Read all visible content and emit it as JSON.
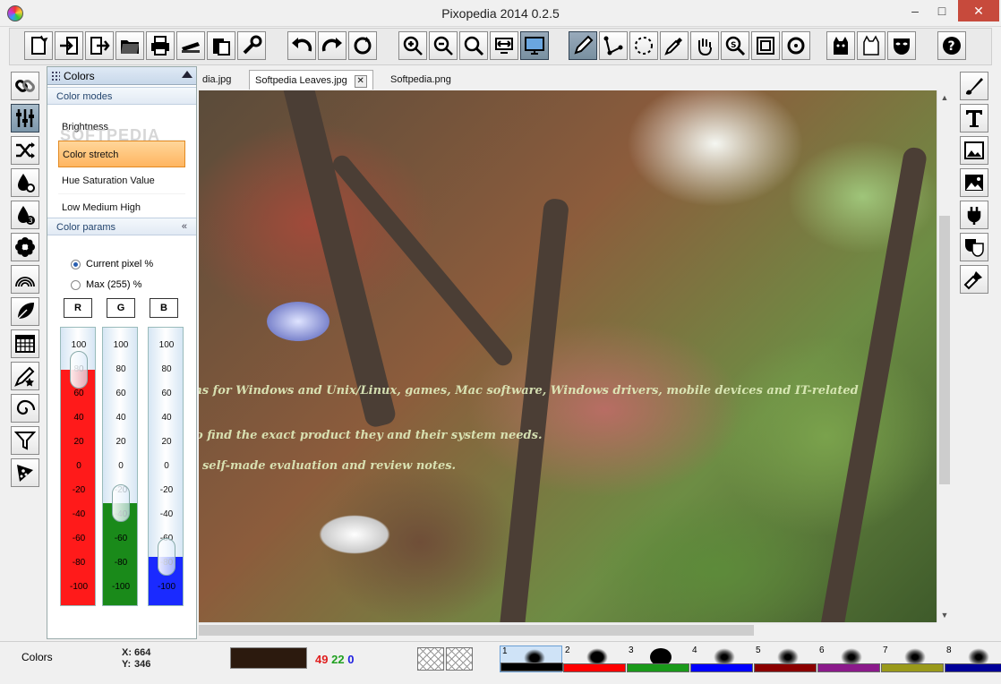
{
  "window": {
    "title": "Pixopedia 2014 0.2.5",
    "min": "–",
    "max": "□",
    "close": "✕"
  },
  "toolbar": {
    "icons": [
      "new-image",
      "import",
      "export",
      "open-folder",
      "print",
      "scan",
      "paste",
      "settings-wrench",
      "undo",
      "redo",
      "refresh",
      "zoom-in",
      "zoom-out",
      "zoom-fit",
      "fit-width",
      "monitor",
      "pen-tool",
      "path-tool",
      "lasso-select",
      "eyedropper",
      "hand-pan",
      "magnifier-s",
      "crop-frame",
      "rotate",
      "cat-mask",
      "cat-outline",
      "theatre-mask",
      "help"
    ]
  },
  "left_tools": [
    "link",
    "sliders",
    "shuffle",
    "ink-drop-gear",
    "ink-drop-3",
    "flower",
    "rainbow",
    "leaf",
    "calendar-grid",
    "brush-star",
    "spiral",
    "funnel",
    "pizza-slice"
  ],
  "right_tools": [
    "brush",
    "text",
    "image-frame",
    "landscape",
    "plug",
    "masks",
    "paint-brush"
  ],
  "panel": {
    "title": "Colors",
    "modes_title": "Color modes",
    "modes": [
      "Brightness",
      "Color stretch",
      "Hue Saturation Value",
      "Low Medium High"
    ],
    "selected_mode": "Color stretch",
    "watermark": "SOFTPEDIA",
    "params_title": "Color params",
    "collapse": "«",
    "radio_current": "Current pixel %",
    "radio_max": "Max (255) %",
    "channels": [
      "R",
      "G",
      "B"
    ],
    "ticks": [
      "100",
      "80",
      "60",
      "40",
      "20",
      "0",
      "-20",
      "-40",
      "-60",
      "-80",
      "-100"
    ],
    "levels": {
      "R": 80,
      "G": -30,
      "B": -75
    },
    "colors": {
      "R": "#ff1a1a",
      "G": "#1a8a1a",
      "B": "#1a2aff"
    }
  },
  "tabs": [
    {
      "label": "Softpedia.jpg",
      "visible_text": "dia.jpg",
      "active": false
    },
    {
      "label": "Softpedia Leaves.jpg",
      "active": true,
      "close": "✕"
    },
    {
      "label": "Softpedia.png",
      "active": false
    }
  ],
  "canvas": {
    "text_lines": [
      "ms for Windows and Unix/Linux, games, Mac software, Windows drivers, mobile devices and IT-related",
      "to find the exact product they and their system needs.",
      "n self-made evaluation and review notes."
    ]
  },
  "scroll": {
    "up": "▲",
    "down": "▼"
  },
  "status": {
    "label": "Colors",
    "x_key": "X:",
    "x": "664",
    "y_key": "Y:",
    "y": "346",
    "swatch_color": "#2c1a0e",
    "r": "49",
    "g": "22",
    "b": "0"
  },
  "brushes": [
    {
      "n": "1",
      "color": "#000000",
      "selected": true
    },
    {
      "n": "2",
      "color": "#ff0000"
    },
    {
      "n": "3",
      "color": "#1a9a1a"
    },
    {
      "n": "4",
      "color": "#0000ff"
    },
    {
      "n": "5",
      "color": "#8b0000"
    },
    {
      "n": "6",
      "color": "#8b1a8b"
    },
    {
      "n": "7",
      "color": "#9a9a1a"
    },
    {
      "n": "8",
      "color": "#000099"
    }
  ]
}
